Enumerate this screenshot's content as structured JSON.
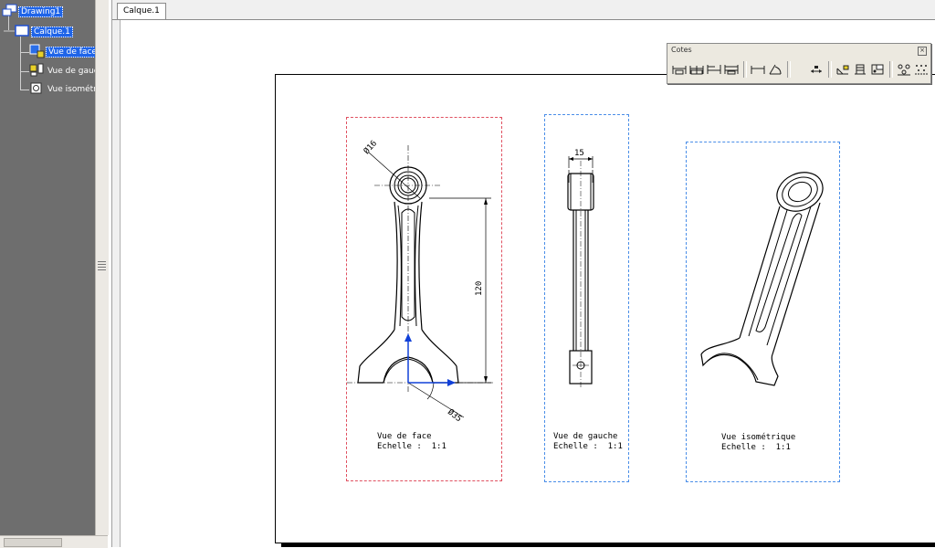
{
  "tree": {
    "root_label": "Drawing1",
    "sheet_label": "Calque.1",
    "views": [
      {
        "label": "Vue de face",
        "selected": true,
        "icon": "front-view-icon"
      },
      {
        "label": "Vue de gauche",
        "selected": false,
        "icon": "left-view-icon"
      },
      {
        "label": "Vue isométrique",
        "selected": false,
        "icon": "isometric-view-icon"
      }
    ]
  },
  "tabs": [
    {
      "label": "Calque.1"
    }
  ],
  "drawing": {
    "views": [
      {
        "name": "Vue de face",
        "line1": "Vue de face",
        "line2": "Echelle :  1:1",
        "frame_color": "#e05060"
      },
      {
        "name": "Vue de gauche",
        "line1": "Vue de gauche",
        "line2": "Echelle :  1:1",
        "frame_color": "#4a8ee8"
      },
      {
        "name": "Vue isométrique",
        "line1": "Vue isométrique",
        "line2": "Echelle :  1:1",
        "frame_color": "#4a8ee8"
      }
    ],
    "dimensions": {
      "small_bore": "Ø16",
      "center_distance": "120",
      "big_bore": "Ø35",
      "thickness": "15"
    },
    "dimension_color": "#1040d8"
  },
  "toolbar": {
    "title": "Cotes",
    "close_symbol": "×",
    "buttons": [
      "dimensions-icon",
      "chained-dimensions-icon",
      "cumulated-dimensions-icon",
      "stacked-dimensions-icon",
      "length-distance-icon",
      "angle-dimension-icon",
      "radius-dimension-icon",
      "chamfer-dimension-icon",
      "thread-dimension-icon",
      "coordinate-dimension-icon",
      "hole-table-icon",
      "point-table-icon"
    ]
  }
}
